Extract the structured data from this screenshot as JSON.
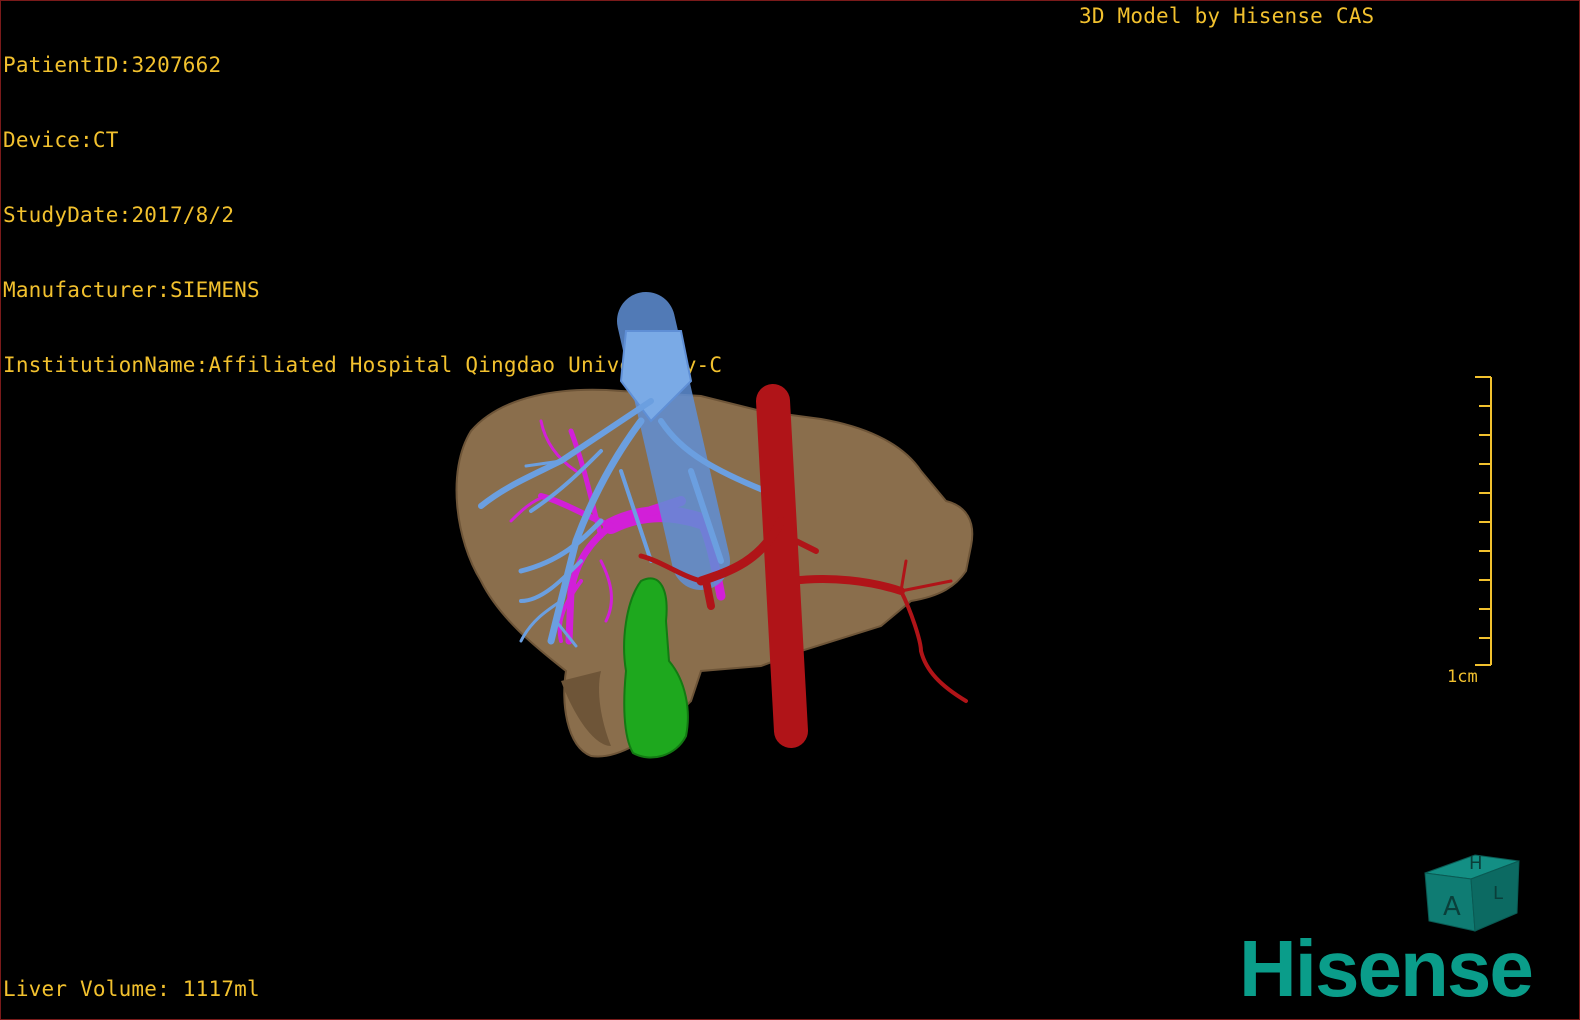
{
  "viewer": {
    "info": [
      {
        "label": "PatientID:",
        "value": "3207662"
      },
      {
        "label": "Device:",
        "value": "CT"
      },
      {
        "label": "StudyDate:",
        "value": "2017/8/2"
      },
      {
        "label": "Manufacturer:",
        "value": "SIEMENS"
      },
      {
        "label": "InstitutionName:",
        "value": "Affiliated Hospital Qingdao University-C"
      }
    ],
    "credit": "3D Model by Hisense CAS",
    "liver_volume": "Liver Volume: 1117ml",
    "scale_bar": {
      "label": "1cm"
    },
    "orientation_cube": {
      "front_label": "A",
      "top_label": "H",
      "side_label": "L"
    },
    "logo": "Hisense"
  },
  "colors": {
    "text": "#f2c12e",
    "liver": "#8a6e4c",
    "hepatic_vein": "#6b9fe0",
    "portal_vein": "#d21fd8",
    "artery": "#b01418",
    "gallbladder": "#1ea81e",
    "logo": "#0a9d8a",
    "cube": "#0f7c73"
  }
}
